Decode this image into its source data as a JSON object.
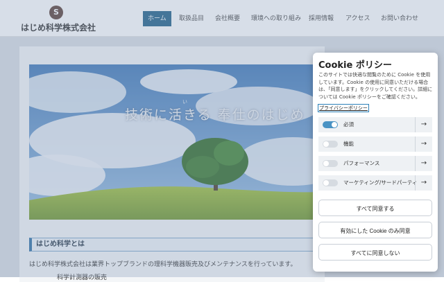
{
  "brand": {
    "logo_mark": "S",
    "name": "はじめ科学株式会社"
  },
  "nav": {
    "items": [
      "ホーム",
      "取扱品目",
      "会社概要",
      "環境への取り組み",
      "採用情報",
      "アクセス",
      "お問い合わせ"
    ],
    "active": "ホーム"
  },
  "hero": {
    "title": "技術に活きる 奉仕のはじめ",
    "ruby": "い"
  },
  "section": {
    "title": "はじめ科学とは",
    "body": "はじめ科学株式会社は業界トップブランドの理科学機器販売及びメンテナンスを行っています。",
    "sub": "科学計測器の販売"
  },
  "cookie": {
    "title": "Cookie ポリシー",
    "description": "このサイトでは快適な閲覧のために Cookie を使用しています。Cookie の使用に同意いただける場合は、「同意します」をクリックしてください。詳細については Cookie ポリシーをご確認ください。",
    "privacy_link": "プライバシーポリシー",
    "categories": [
      {
        "label": "必須",
        "enabled": true
      },
      {
        "label": "機能",
        "enabled": false
      },
      {
        "label": "パフォーマンス",
        "enabled": false
      },
      {
        "label": "マーケティング/サードパーティ",
        "enabled": false
      }
    ],
    "arrow": "→",
    "buttons": {
      "accept_all": "すべて同意する",
      "accept_selected": "有効にした Cookie のみ同意",
      "reject_all": "すべてに同意しない"
    }
  },
  "colors": {
    "nav_active": "#1e5f86",
    "toggle_on": "#4a93c4",
    "accent": "#2e6fa3"
  }
}
